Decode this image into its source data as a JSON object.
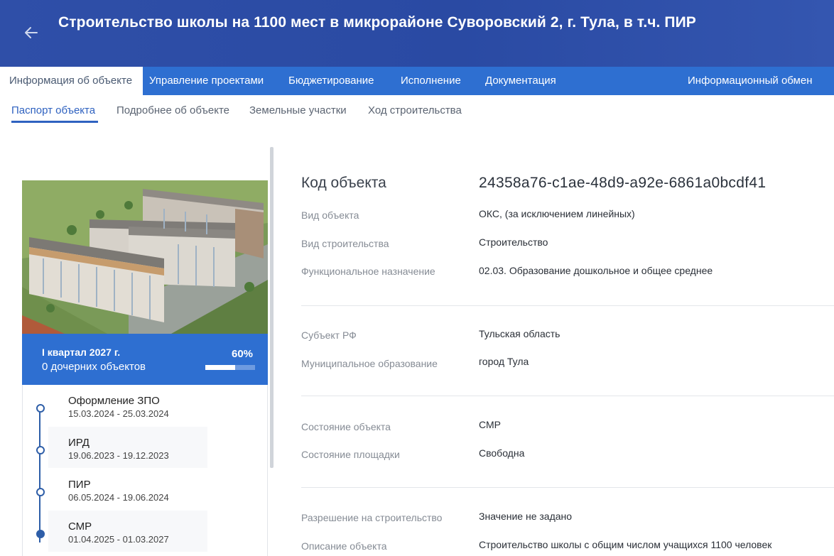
{
  "header": {
    "title": "Строительство школы на 1100 мест в микрорайоне Суворовский 2, г. Тула, в т.ч. ПИР"
  },
  "tabs": [
    {
      "label": "Информация об объекте"
    },
    {
      "label": "Управление проектами"
    },
    {
      "label": "Бюджетирование"
    },
    {
      "label": "Исполнение"
    },
    {
      "label": "Документация"
    },
    {
      "label": "Информационный обмен"
    }
  ],
  "subtabs": [
    {
      "label": "Паспорт объекта"
    },
    {
      "label": "Подробнее об объекте"
    },
    {
      "label": "Земельные участки"
    },
    {
      "label": "Ход строительства"
    }
  ],
  "status": {
    "quarter": "I квартал 2027 г.",
    "children": "0 дочерних объектов",
    "percent_text": "60%",
    "progress": 0.6
  },
  "stages": [
    {
      "name": "Оформление ЗПО",
      "dates": "15.03.2024 - 25.03.2024"
    },
    {
      "name": "ИРД",
      "dates": "19.06.2023 - 19.12.2023"
    },
    {
      "name": "ПИР",
      "dates": "06.05.2024 - 19.06.2024"
    },
    {
      "name": "СМР",
      "dates": "01.04.2025 - 01.03.2027"
    }
  ],
  "info": {
    "code_label": "Код объекта",
    "code_value": "24358a76-c1ae-48d9-a92e-6861a0bcdf41",
    "fields": [
      {
        "label": "Вид объекта",
        "value": "ОКС, (за исключением линейных)"
      },
      {
        "label": "Вид строительства",
        "value": "Строительство"
      },
      {
        "label": "Функциональное назначение",
        "value": "02.03. Образование дошкольное и общее среднее"
      },
      {
        "label": "Субъект РФ",
        "value": "Тульская область"
      },
      {
        "label": "Муниципальное образование",
        "value": "город Тула"
      },
      {
        "label": "Состояние объекта",
        "value": "СМР"
      },
      {
        "label": "Состояние площадки",
        "value": "Свободна"
      },
      {
        "label": "Разрешение на строительство",
        "value": "Значение не задано"
      },
      {
        "label": "Описание объекта",
        "value": "Строительство школы с общим числом учащихся 1100 человек"
      }
    ]
  },
  "colors": {
    "header": "#2f4fa8",
    "tab_bar": "#2e6fd1",
    "accent": "#2f62c0",
    "timeline": "#2e5ea8"
  },
  "icons": {
    "back": "arrow-left-icon"
  }
}
